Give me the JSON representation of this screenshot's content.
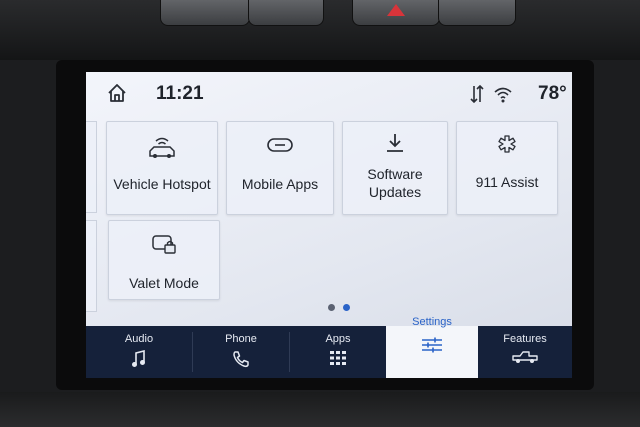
{
  "status_bar": {
    "time": "11:21",
    "temperature": "78°"
  },
  "tiles": [
    {
      "label": "Vehicle Hotspot",
      "icon": "car-wifi-icon"
    },
    {
      "label": "Mobile Apps",
      "icon": "link-icon"
    },
    {
      "label": "Software Updates",
      "label_lines": [
        "Software",
        "Updates"
      ],
      "icon": "download-icon"
    },
    {
      "label": "911 Assist",
      "icon": "asterisk-medical-icon"
    },
    {
      "label": "Valet Mode",
      "icon": "valet-lock-icon"
    }
  ],
  "pager": {
    "pages": 2,
    "current": 2
  },
  "nav": [
    {
      "label": "Audio",
      "icon": "music-note-icon",
      "active": false
    },
    {
      "label": "Phone",
      "icon": "phone-icon",
      "active": false
    },
    {
      "label": "Apps",
      "icon": "apps-grid-icon",
      "active": false
    },
    {
      "label": "Settings",
      "icon": "sliders-icon",
      "active": true
    },
    {
      "label": "Features",
      "icon": "truck-icon",
      "active": false
    }
  ],
  "colors": {
    "accent": "#2a63c8",
    "navbar": "#15213a",
    "screen_bg": "#e6eaf2"
  }
}
